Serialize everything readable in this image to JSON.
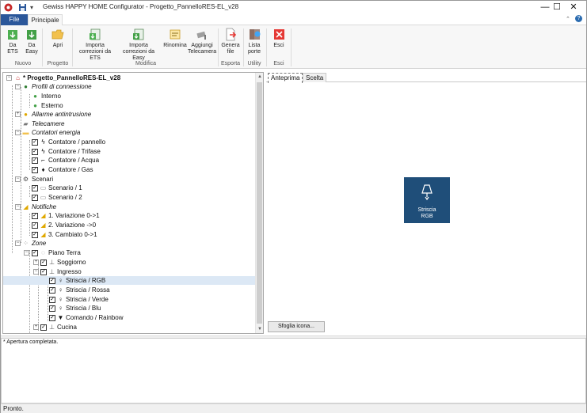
{
  "window": {
    "title": "Gewiss HAPPY HOME Configurator - Progetto_PannelloRES-EL_v28",
    "minimize": "—",
    "maximize": "☐",
    "close": "✕"
  },
  "menu_tabs": {
    "file": "File",
    "principale": "Principale"
  },
  "ribbon": {
    "da_ets": "Da ETS",
    "da_easy": "Da Easy",
    "apri": "Apri",
    "importa_ets": "Importa correzioni da ETS",
    "importa_easy": "Importa correzioni da Easy",
    "rinomina": "Rinomina",
    "aggiungi_telecamera": "Aggiungi Telecamera",
    "genera_file": "Genera file",
    "lista_porte": "Lista porte",
    "esci": "Esci",
    "groups": {
      "nuovo": "Nuovo",
      "progetto": "Progetto",
      "modifica": "Modifica",
      "esporta": "Esporta",
      "utility": "Utility",
      "esci": "Esci"
    }
  },
  "tree": {
    "root": "* Progetto_PannelloRES-EL_v28",
    "profili": "Profili di connessione",
    "interno": "Interno",
    "esterno": "Esterno",
    "allarme": "Allarme antintrusione",
    "telecamere": "Telecamere",
    "contatori": "Contatori energia",
    "contatore_pannello": "Contatore / pannello",
    "contatore_trifase": "Contatore / Trifase",
    "contatore_acqua": "Contatore / Acqua",
    "contatore_gas": "Contatore / Gas",
    "scenari": "Scenari",
    "scenario1": "Scenario / 1",
    "scenario2": "Scenario / 2",
    "notifiche": "Notifiche",
    "notifica1": "1. Variazione 0->1",
    "notifica2": "2. Variazione ->0",
    "notifica3": "3. Cambiato 0->1",
    "zone": "Zone",
    "piano_terra": "Piano Terra",
    "soggiorno": "Soggiorno",
    "ingresso": "Ingresso",
    "striscia_rgb": "Striscia / RGB",
    "striscia_rossa": "Striscia / Rossa",
    "striscia_verde": "Striscia / Verde",
    "striscia_blu": "Striscia / Blu",
    "comando_rainbow": "Comando / Rainbow",
    "cucina": "Cucina"
  },
  "preview": {
    "tab_anteprima": "Anteprima",
    "tab_scelta": "Scelta",
    "tile_label_1": "Striscia",
    "tile_label_2": "RGB",
    "tile_color": "#1f4e79",
    "browse_button": "Sfoglia icona..."
  },
  "log": {
    "line1": "* Apertura completata."
  },
  "status": {
    "text": "Pronto."
  },
  "colors": {
    "file_tab": "#2b579a",
    "tile": "#1f4e79"
  }
}
